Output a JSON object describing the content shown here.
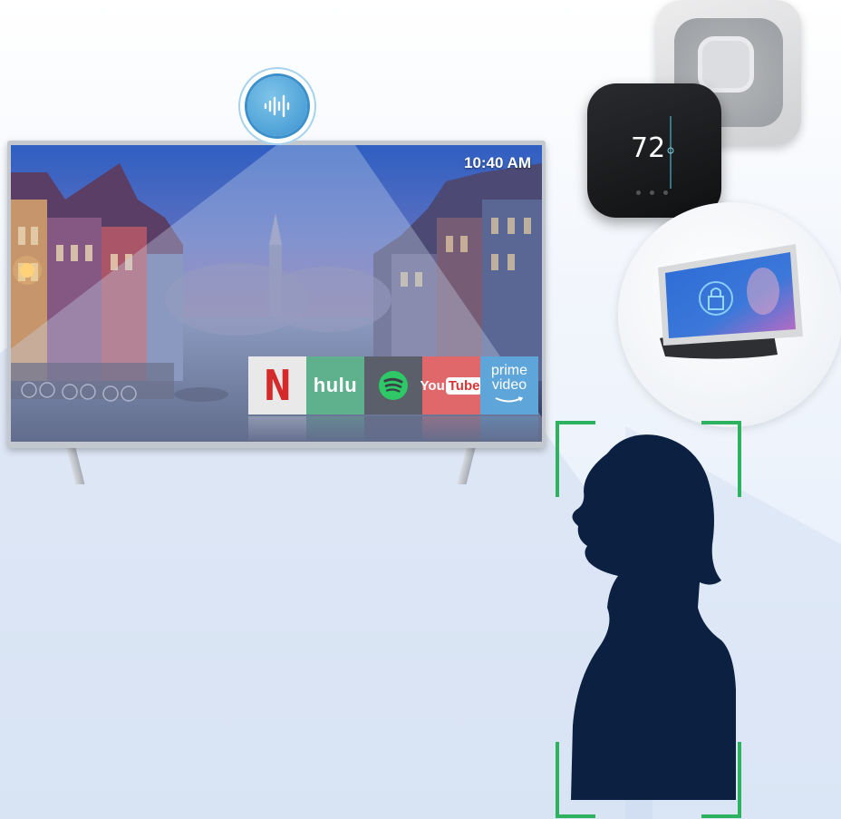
{
  "tv": {
    "clock": "10:40 AM",
    "apps": {
      "netflix": "N",
      "hulu": "hulu",
      "youtube_a": "You",
      "youtube_b": "Tube",
      "prime_a": "prime",
      "prime_b": "video"
    }
  },
  "thermostat": {
    "temperature": "72"
  },
  "icons": {
    "mic": "voice-waveform-icon",
    "spotify": "spotify-logo",
    "speaker": "smart-speaker-device",
    "display": "smart-display-device",
    "person": "person-silhouette"
  },
  "colors": {
    "mic_blue": "#3a93cf",
    "bracket_green": "#2db35f",
    "silhouette": "#0c2142"
  }
}
